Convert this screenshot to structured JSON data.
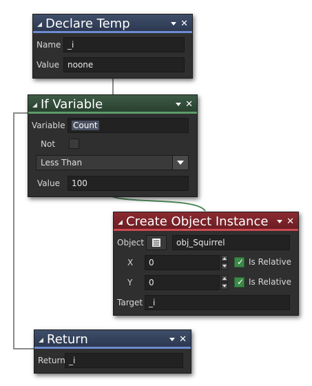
{
  "declare_temp": {
    "title": "Declare Temp",
    "name_label": "Name",
    "name_value": "_i",
    "value_label": "Value",
    "value_value": "noone"
  },
  "if_variable": {
    "title": "If Variable",
    "variable_label": "Variable",
    "variable_value": "Count",
    "not_label": "Not",
    "not_checked": false,
    "comparison": "Less Than",
    "value_label": "Value",
    "value_value": "100"
  },
  "create_instance": {
    "title": "Create Object Instance",
    "object_label": "Object",
    "object_value": "obj_Squirrel",
    "x_label": "X",
    "x_value": "0",
    "x_relative_label": "Is Relative",
    "x_relative": true,
    "y_label": "Y",
    "y_value": "0",
    "y_relative_label": "Is Relative",
    "y_relative": true,
    "target_label": "Target",
    "target_value": "_i"
  },
  "return_block": {
    "title": "Return",
    "return_label": "Return",
    "return_value": "_i"
  },
  "icons": {
    "collapse": "collapse-triangle-icon",
    "menu": "dropdown-arrow-icon",
    "close": "close-x-icon",
    "object": "object-document-icon",
    "check": "checkmark-icon"
  },
  "colors": {
    "header_blue": "#2c3850",
    "header_green": "#29402f",
    "header_red": "#6c1d23",
    "panel": "#2f2f2f",
    "checkbox_on": "#3c8a47"
  }
}
